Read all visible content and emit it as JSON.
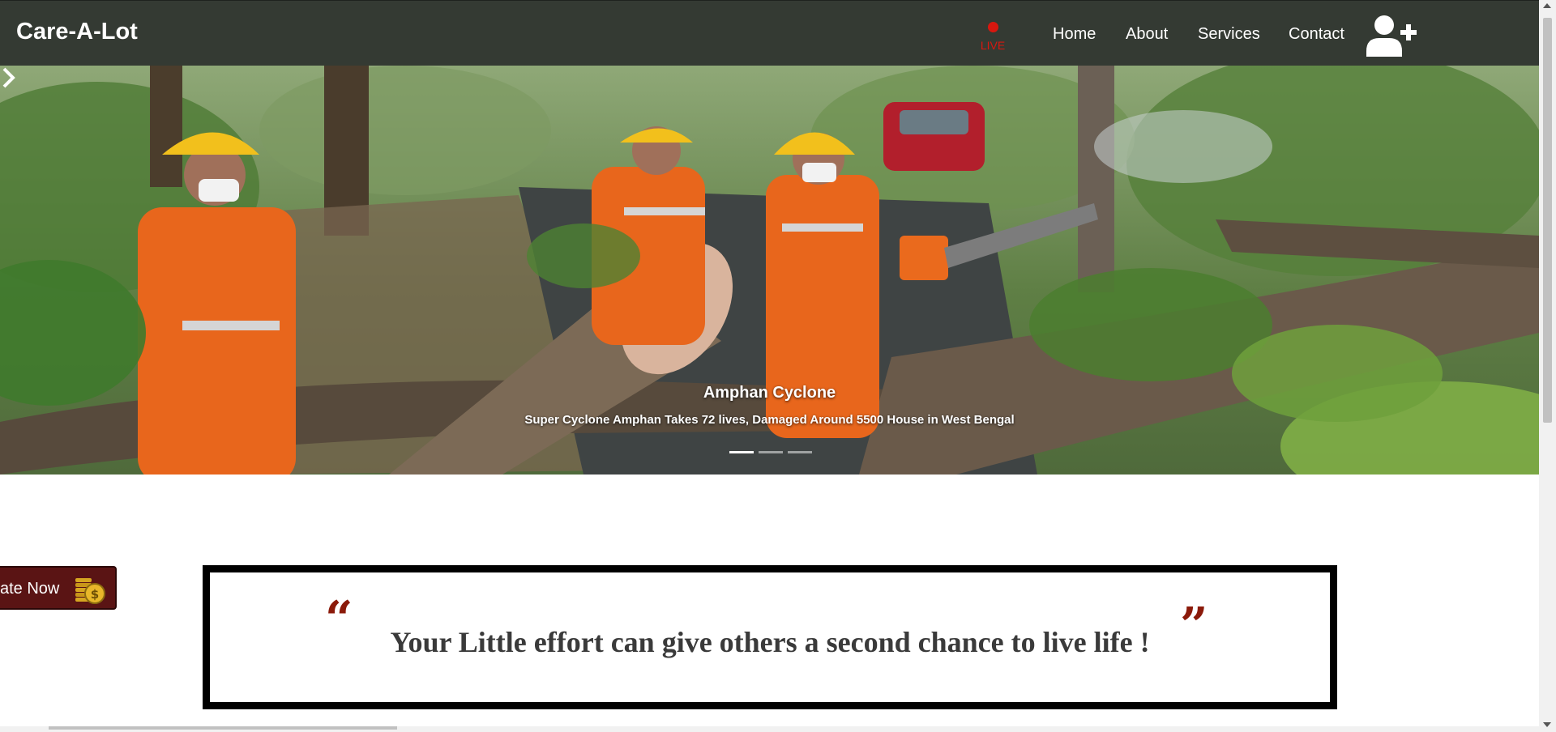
{
  "brand": {
    "name": "Care-A-Lot"
  },
  "live": {
    "label": "LIVE",
    "color": "#d8170f"
  },
  "nav": {
    "items": [
      {
        "label": "Home"
      },
      {
        "label": "About"
      },
      {
        "label": "Services"
      },
      {
        "label": "Contact"
      }
    ],
    "user_icon": "user-plus-icon"
  },
  "carousel": {
    "slide": {
      "title": "Amphan Cyclone",
      "text": "Super Cyclone Amphan Takes 72 lives, Damaged Around 5500 House in West Bengal"
    },
    "indicator_count": 3,
    "active_index": 0,
    "next_icon": "chevron-right-icon"
  },
  "donate": {
    "label": "ate Now",
    "icon": "coins-icon",
    "color": "#5a1414"
  },
  "quote": {
    "open_mark": "“",
    "close_mark": "”",
    "text": "Your Little effort can give others a second chance to live life !",
    "mark_color": "#8b1a0a"
  },
  "colors": {
    "navbar": "#343a33",
    "accent": "#d8170f"
  }
}
